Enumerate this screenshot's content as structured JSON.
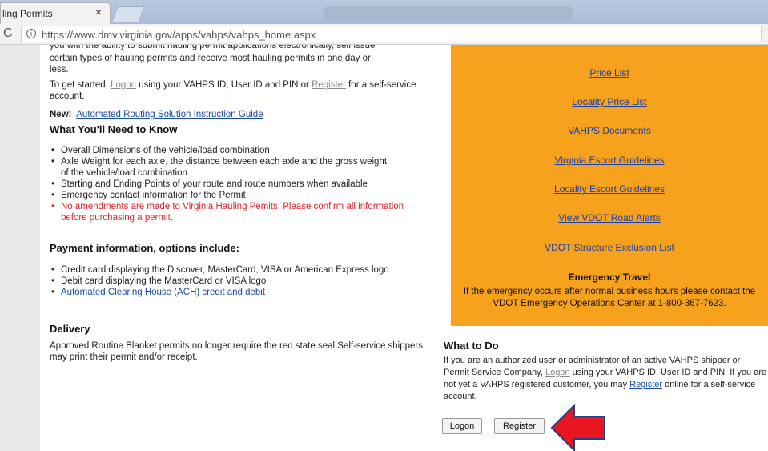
{
  "browser": {
    "tab_title": "ling Permits",
    "tab_close": "×",
    "url": "https://www.dmv.virginia.gov/apps/vahps/vahps_home.aspx"
  },
  "intro": {
    "truncated_line": "you with the ability to submit hauling permit applications electronically, self issue",
    "line2": "certain types of hauling permits and receive most hauling permits in one day or",
    "line3": "less.",
    "start_pre": "To get started, ",
    "logon_link": "Logon",
    "start_mid": " using your VAHPS ID, User ID and PIN or ",
    "register_link": "Register",
    "start_post": " for a self-service account.",
    "new_label": "New!",
    "new_link": "Automated Routing Solution Instruction Guide"
  },
  "need_to_know": {
    "heading": "What You'll Need to Know",
    "items": [
      "Overall Dimensions of the vehicle/load combination",
      "Axle Weight for each axle, the distance between each axle and the gross weight of the vehicle/load combination",
      "Starting and Ending Points of your route and route numbers when available",
      "Emergency contact information for the Permit"
    ],
    "warning": "No amendments are made to Virginia Hauling Pemits. Please confirm all information before purchasing a permit."
  },
  "payment": {
    "heading": "Payment information, options include:",
    "items": [
      "Credit card displaying the Discover, MasterCard, VISA or American Express logo",
      "Debit card displaying the MasterCard or VISA logo"
    ],
    "ach_link": "Automated Clearing House (ACH) credit and debit"
  },
  "delivery": {
    "heading": "Delivery",
    "text": "Approved Routine Blanket permits no longer require the red state seal.Self-service shippers may print their permit and/or receipt."
  },
  "sidebar": {
    "links": [
      "Price List",
      "Locality Price List",
      "VAHPS Documents",
      "Virginia Escort Guidelines",
      "Locality Escort Guidelines",
      "View VDOT Road Alerts",
      "VDOT Structure Exclusion List"
    ],
    "emergency_heading": "Emergency Travel",
    "emergency_text": "If the emergency occurs after normal business hours please contact the VDOT Emergency Operations Center at 1-800-367-7623."
  },
  "what_to_do": {
    "heading": "What to Do",
    "p1": "If you are an authorized user or administrator of an active VAHPS shipper or Permit Service Company, ",
    "logon_link": "Logon",
    "p2": " using your VAHPS ID, User ID and PIN. If you are not yet a VAHPS registered customer, you may ",
    "register_link": "Register",
    "p3": " online for a self-service account.",
    "logon_button": "Logon",
    "register_button": "Register"
  },
  "colors": {
    "sidebar_bg": "#f7a21d",
    "arrow": "#e8161f",
    "warning_text": "#e0242a",
    "link": "#1a4aa8"
  }
}
